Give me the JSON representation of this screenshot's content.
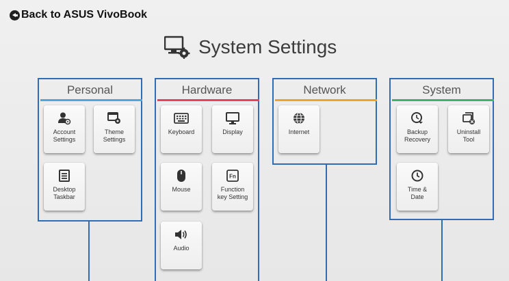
{
  "back_label": "Back to ASUS VivoBook",
  "title": "System Settings",
  "colors": {
    "panel_border": "#2f6cb4",
    "personal": "#4aa8e0",
    "hardware": "#e8415a",
    "network": "#f2a12b",
    "system": "#3cb36a"
  },
  "categories": {
    "personal": {
      "label": "Personal",
      "tiles": [
        {
          "label": "Account\nSettings",
          "icon": "account-icon"
        },
        {
          "label": "Theme\nSettings",
          "icon": "theme-icon"
        },
        {
          "label": "Desktop\nTaskbar",
          "icon": "taskbar-icon"
        }
      ]
    },
    "hardware": {
      "label": "Hardware",
      "tiles": [
        {
          "label": "Keyboard",
          "icon": "keyboard-icon"
        },
        {
          "label": "Display",
          "icon": "display-icon"
        },
        {
          "label": "Mouse",
          "icon": "mouse-icon"
        },
        {
          "label": "Function\nkey Setting",
          "icon": "function-key-icon"
        },
        {
          "label": "Audio",
          "icon": "audio-icon"
        }
      ]
    },
    "network": {
      "label": "Network",
      "tiles": [
        {
          "label": "Internet",
          "icon": "internet-icon"
        }
      ]
    },
    "system": {
      "label": "System",
      "tiles": [
        {
          "label": "Backup\nRecovery",
          "icon": "backup-icon"
        },
        {
          "label": "Uninstall\nTool",
          "icon": "uninstall-icon"
        },
        {
          "label": "Time &\nDate",
          "icon": "clock-icon"
        }
      ]
    }
  }
}
